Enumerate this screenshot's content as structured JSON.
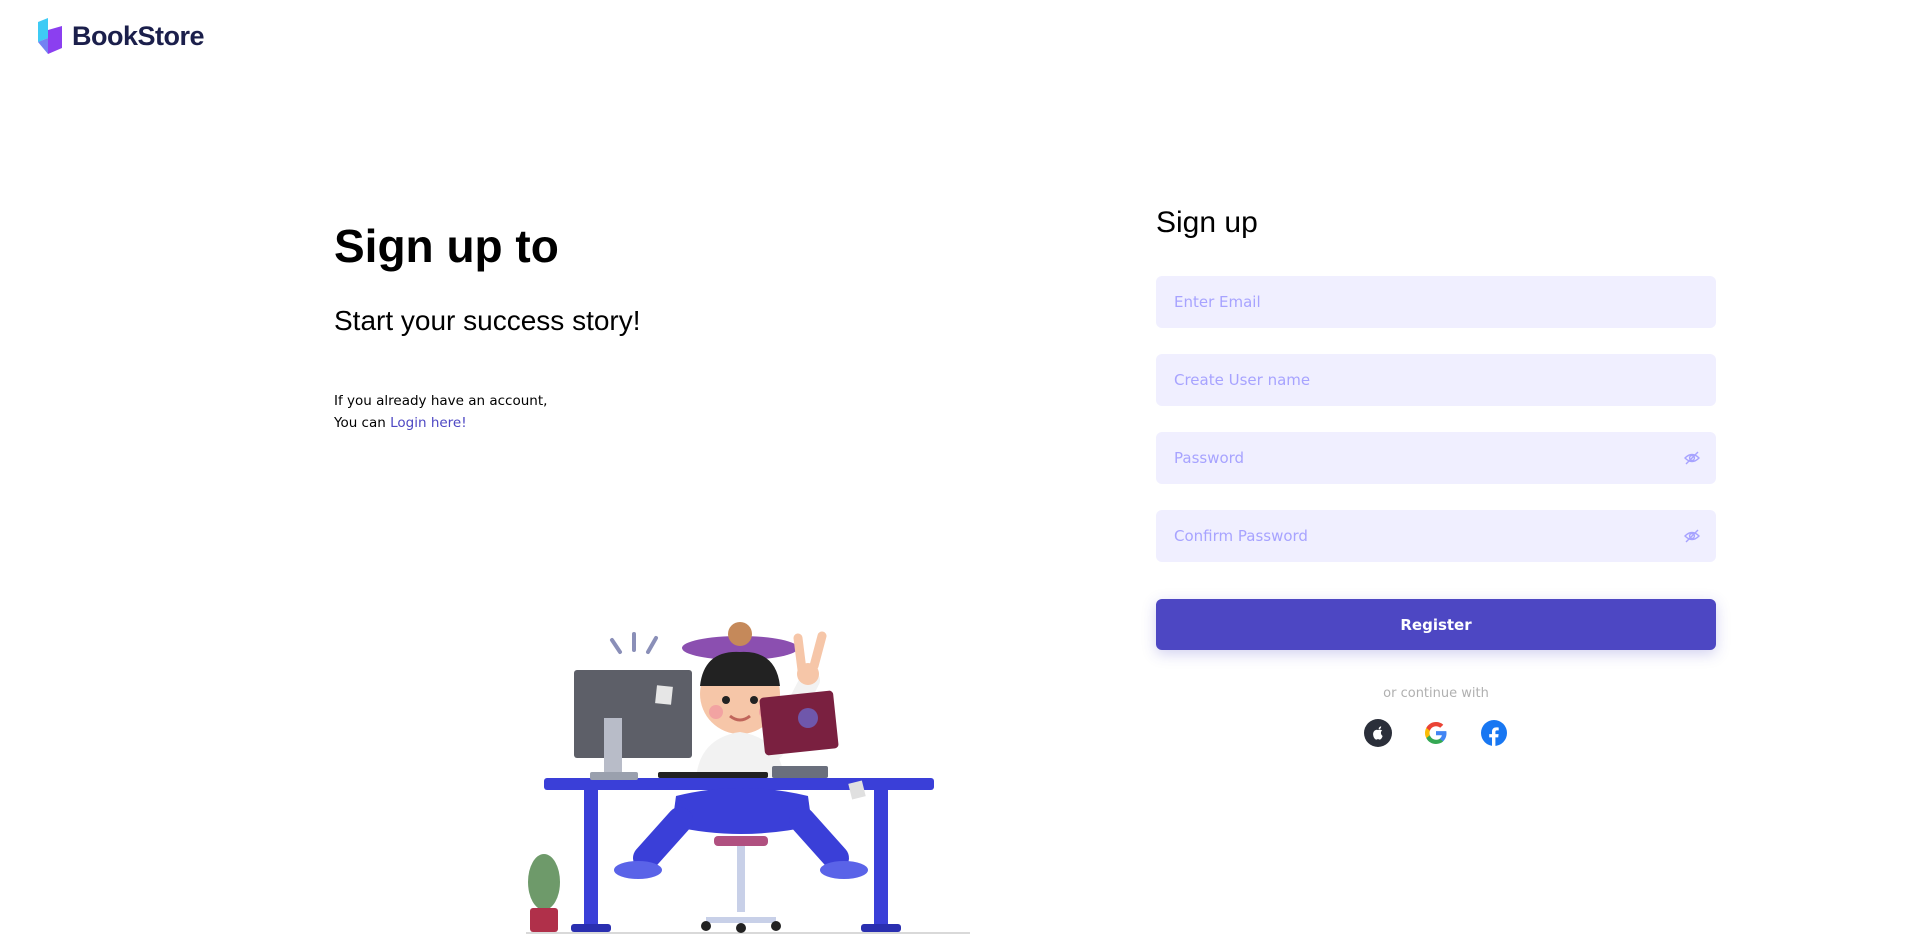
{
  "brand": {
    "name": "BookStore"
  },
  "hero": {
    "title": "Sign up to",
    "subtitle": "Start your success story!",
    "note_line1": "If you already have an account,",
    "note_prefix": "You can",
    "login_link": "Login here!"
  },
  "form": {
    "title": "Sign up",
    "email_placeholder": "Enter Email",
    "username_placeholder": "Create User name",
    "password_placeholder": "Password",
    "confirm_placeholder": "Confirm Password",
    "register_label": "Register",
    "continue_text": "or continue with"
  },
  "social": [
    {
      "icon": "apple-icon"
    },
    {
      "icon": "google-icon"
    },
    {
      "icon": "facebook-icon"
    }
  ],
  "colors": {
    "accent": "#4d47c3",
    "field_bg": "#f0efff",
    "placeholder": "#a7a3ff",
    "brand_text": "#1b1f4b"
  }
}
